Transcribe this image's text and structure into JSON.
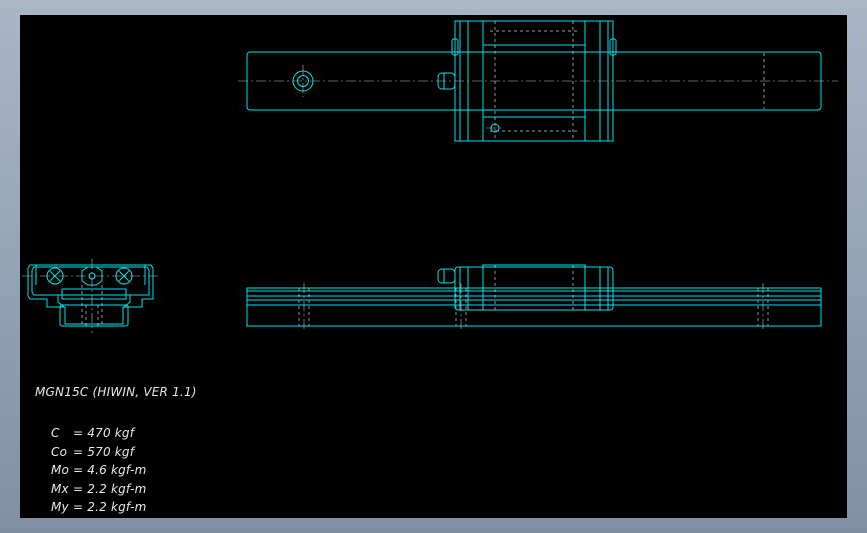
{
  "window": {
    "background_color": "#000000",
    "frame_color": "#8d9db1"
  },
  "drawing": {
    "line_color": "#00e5ee",
    "hidden_line_color": "#d0d0d0",
    "center_line_color": "#bfbfbf"
  },
  "specs": {
    "title": "MGN15C (HIWIN, VER 1.1)",
    "lines": [
      {
        "symbol": "C",
        "value": "= 470 kgf"
      },
      {
        "symbol": "Co",
        "value": "= 570 kgf"
      },
      {
        "symbol": "Mo",
        "value": "= 4.6 kgf-m"
      },
      {
        "symbol": "Mx",
        "value": "= 2.2 kgf-m"
      },
      {
        "symbol": "My",
        "value": "= 2.2 kgf-m"
      }
    ]
  }
}
